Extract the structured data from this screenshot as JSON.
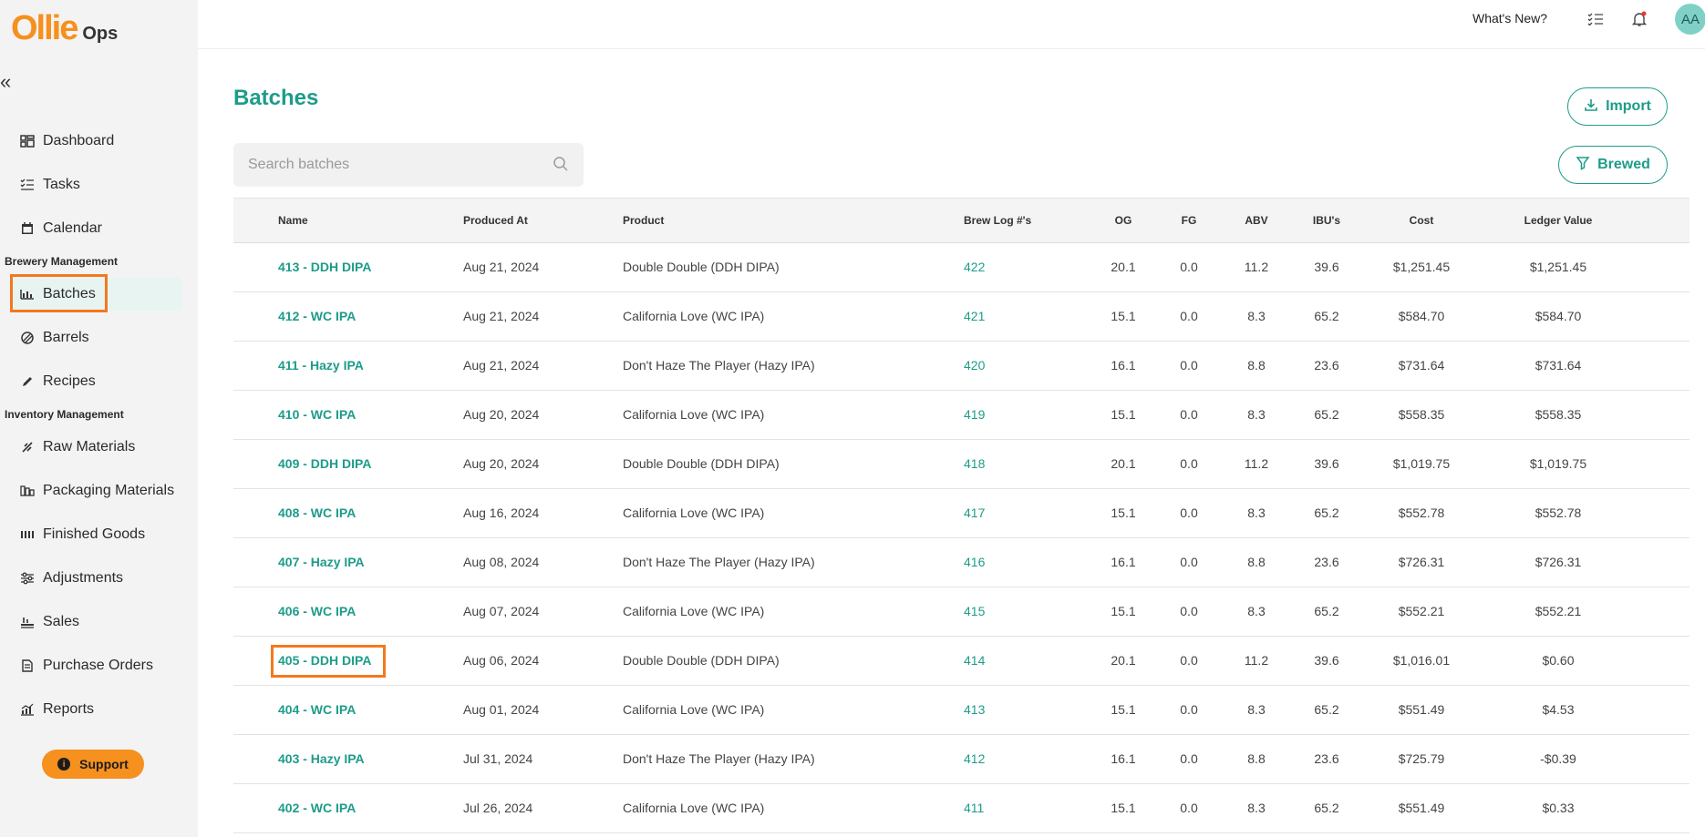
{
  "app": {
    "logo_main": "Ollie",
    "logo_sub": "Ops"
  },
  "sidebar": {
    "collapse_glyph": "«",
    "items_top": [
      {
        "label": "Dashboard",
        "icon": "dashboard-icon"
      },
      {
        "label": "Tasks",
        "icon": "tasks-icon"
      },
      {
        "label": "Calendar",
        "icon": "calendar-icon"
      }
    ],
    "section_brewery": "Brewery Management",
    "items_brewery": [
      {
        "label": "Batches",
        "icon": "batches-icon",
        "active": true
      },
      {
        "label": "Barrels",
        "icon": "barrels-icon"
      },
      {
        "label": "Recipes",
        "icon": "recipes-icon"
      }
    ],
    "section_inventory": "Inventory Management",
    "items_inventory": [
      {
        "label": "Raw Materials",
        "icon": "raw-materials-icon"
      },
      {
        "label": "Packaging Materials",
        "icon": "packaging-icon"
      },
      {
        "label": "Finished Goods",
        "icon": "finished-goods-icon"
      },
      {
        "label": "Adjustments",
        "icon": "adjustments-icon"
      },
      {
        "label": "Sales",
        "icon": "sales-icon"
      },
      {
        "label": "Purchase Orders",
        "icon": "purchase-orders-icon"
      },
      {
        "label": "Reports",
        "icon": "reports-icon"
      }
    ],
    "support_label": "Support"
  },
  "topbar": {
    "whats_new": "What's New?",
    "avatar_initials": "AA"
  },
  "main": {
    "title": "Batches",
    "import_label": "Import",
    "brewed_label": "Brewed",
    "search_placeholder": "Search batches",
    "columns": [
      "Name",
      "Produced At",
      "Product",
      "Brew Log #'s",
      "OG",
      "FG",
      "ABV",
      "IBU's",
      "Cost",
      "Ledger Value"
    ],
    "rows": [
      [
        "413 - DDH DIPA",
        "Aug 21, 2024",
        "Double Double (DDH DIPA)",
        "422",
        "20.1",
        "0.0",
        "11.2",
        "39.6",
        "$1,251.45",
        "$1,251.45"
      ],
      [
        "412 - WC IPA",
        "Aug 21, 2024",
        "California Love (WC IPA)",
        "421",
        "15.1",
        "0.0",
        "8.3",
        "65.2",
        "$584.70",
        "$584.70"
      ],
      [
        "411 - Hazy IPA",
        "Aug 21, 2024",
        "Don't Haze The Player (Hazy IPA)",
        "420",
        "16.1",
        "0.0",
        "8.8",
        "23.6",
        "$731.64",
        "$731.64"
      ],
      [
        "410 - WC IPA",
        "Aug 20, 2024",
        "California Love (WC IPA)",
        "419",
        "15.1",
        "0.0",
        "8.3",
        "65.2",
        "$558.35",
        "$558.35"
      ],
      [
        "409 - DDH DIPA",
        "Aug 20, 2024",
        "Double Double (DDH DIPA)",
        "418",
        "20.1",
        "0.0",
        "11.2",
        "39.6",
        "$1,019.75",
        "$1,019.75"
      ],
      [
        "408 - WC IPA",
        "Aug 16, 2024",
        "California Love (WC IPA)",
        "417",
        "15.1",
        "0.0",
        "8.3",
        "65.2",
        "$552.78",
        "$552.78"
      ],
      [
        "407 - Hazy IPA",
        "Aug 08, 2024",
        "Don't Haze The Player (Hazy IPA)",
        "416",
        "16.1",
        "0.0",
        "8.8",
        "23.6",
        "$726.31",
        "$726.31"
      ],
      [
        "406 - WC IPA",
        "Aug 07, 2024",
        "California Love (WC IPA)",
        "415",
        "15.1",
        "0.0",
        "8.3",
        "65.2",
        "$552.21",
        "$552.21"
      ],
      [
        "405 - DDH DIPA",
        "Aug 06, 2024",
        "Double Double (DDH DIPA)",
        "414",
        "20.1",
        "0.0",
        "11.2",
        "39.6",
        "$1,016.01",
        "$0.60"
      ],
      [
        "404 - WC IPA",
        "Aug 01, 2024",
        "California Love (WC IPA)",
        "413",
        "15.1",
        "0.0",
        "8.3",
        "65.2",
        "$551.49",
        "$4.53"
      ],
      [
        "403 - Hazy IPA",
        "Jul 31, 2024",
        "Don't Haze The Player (Hazy IPA)",
        "412",
        "16.1",
        "0.0",
        "8.8",
        "23.6",
        "$725.79",
        "-$0.39"
      ],
      [
        "402 - WC IPA",
        "Jul 26, 2024",
        "California Love (WC IPA)",
        "411",
        "15.1",
        "0.0",
        "8.3",
        "65.2",
        "$551.49",
        "$0.33"
      ]
    ]
  },
  "colors": {
    "accent": "#1d9c89",
    "brand_orange": "#f6901e",
    "highlight": "#f3791e"
  }
}
